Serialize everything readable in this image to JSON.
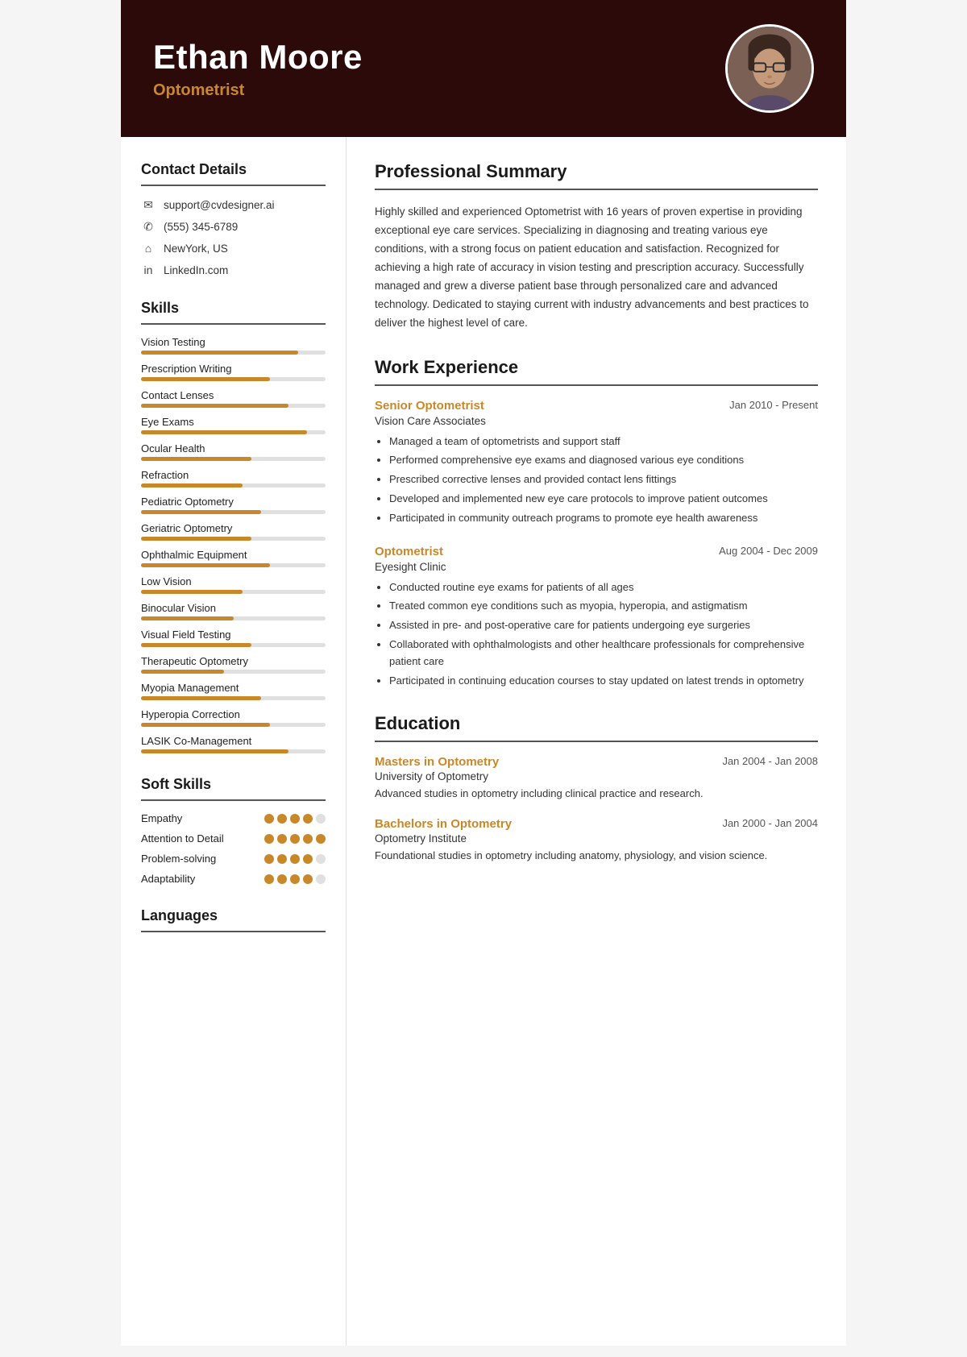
{
  "header": {
    "name": "Ethan Moore",
    "title": "Optometrist",
    "avatar_alt": "Ethan Moore photo"
  },
  "sidebar": {
    "contact_heading": "Contact Details",
    "contact": [
      {
        "icon": "✉",
        "type": "email",
        "value": "support@cvdesigner.ai"
      },
      {
        "icon": "✆",
        "type": "phone",
        "value": "(555) 345-6789"
      },
      {
        "icon": "⌂",
        "type": "location",
        "value": "NewYork, US"
      },
      {
        "icon": "in",
        "type": "linkedin",
        "value": "LinkedIn.com"
      }
    ],
    "skills_heading": "Skills",
    "skills": [
      {
        "name": "Vision Testing",
        "pct": 85
      },
      {
        "name": "Prescription Writing",
        "pct": 70
      },
      {
        "name": "Contact Lenses",
        "pct": 80
      },
      {
        "name": "Eye Exams",
        "pct": 90
      },
      {
        "name": "Ocular Health",
        "pct": 60
      },
      {
        "name": "Refraction",
        "pct": 55
      },
      {
        "name": "Pediatric Optometry",
        "pct": 65
      },
      {
        "name": "Geriatric Optometry",
        "pct": 60
      },
      {
        "name": "Ophthalmic Equipment",
        "pct": 70
      },
      {
        "name": "Low Vision",
        "pct": 55
      },
      {
        "name": "Binocular Vision",
        "pct": 50
      },
      {
        "name": "Visual Field Testing",
        "pct": 60
      },
      {
        "name": "Therapeutic Optometry",
        "pct": 45
      },
      {
        "name": "Myopia Management",
        "pct": 65
      },
      {
        "name": "Hyperopia Correction",
        "pct": 70
      },
      {
        "name": "LASIK Co-Management",
        "pct": 80
      }
    ],
    "soft_skills_heading": "Soft Skills",
    "soft_skills": [
      {
        "name": "Empathy",
        "filled": 4,
        "total": 5
      },
      {
        "name": "Attention to Detail",
        "filled": 5,
        "total": 5
      },
      {
        "name": "Problem-solving",
        "filled": 4,
        "total": 5
      },
      {
        "name": "Adaptability",
        "filled": 4,
        "total": 5
      }
    ],
    "languages_heading": "Languages"
  },
  "main": {
    "summary_heading": "Professional Summary",
    "summary_text": "Highly skilled and experienced Optometrist with 16 years of proven expertise in providing exceptional eye care services. Specializing in diagnosing and treating various eye conditions, with a strong focus on patient education and satisfaction. Recognized for achieving a high rate of accuracy in vision testing and prescription accuracy. Successfully managed and grew a diverse patient base through personalized care and advanced technology. Dedicated to staying current with industry advancements and best practices to deliver the highest level of care.",
    "experience_heading": "Work Experience",
    "jobs": [
      {
        "title": "Senior Optometrist",
        "company": "Vision Care Associates",
        "date": "Jan 2010 - Present",
        "bullets": [
          "Managed a team of optometrists and support staff",
          "Performed comprehensive eye exams and diagnosed various eye conditions",
          "Prescribed corrective lenses and provided contact lens fittings",
          "Developed and implemented new eye care protocols to improve patient outcomes",
          "Participated in community outreach programs to promote eye health awareness"
        ]
      },
      {
        "title": "Optometrist",
        "company": "Eyesight Clinic",
        "date": "Aug 2004 - Dec 2009",
        "bullets": [
          "Conducted routine eye exams for patients of all ages",
          "Treated common eye conditions such as myopia, hyperopia, and astigmatism",
          "Assisted in pre- and post-operative care for patients undergoing eye surgeries",
          "Collaborated with ophthalmologists and other healthcare professionals for comprehensive patient care",
          "Participated in continuing education courses to stay updated on latest trends in optometry"
        ]
      }
    ],
    "education_heading": "Education",
    "education": [
      {
        "degree": "Masters in Optometry",
        "school": "University of Optometry",
        "date": "Jan 2004 - Jan 2008",
        "desc": "Advanced studies in optometry including clinical practice and research."
      },
      {
        "degree": "Bachelors in Optometry",
        "school": "Optometry Institute",
        "date": "Jan 2000 - Jan 2004",
        "desc": "Foundational studies in optometry including anatomy, physiology, and vision science."
      }
    ]
  }
}
